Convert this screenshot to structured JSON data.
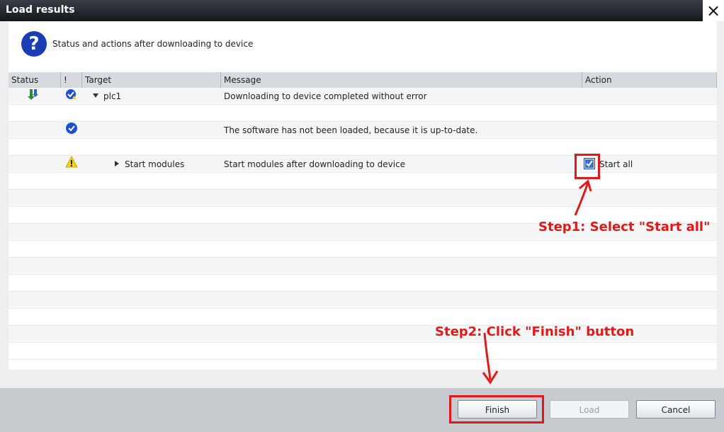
{
  "dialog": {
    "title": "Load results",
    "close_label": "×",
    "header_text": "Status and actions after downloading to device"
  },
  "table": {
    "columns": [
      "Status",
      "!",
      "Target",
      "Message",
      "Action"
    ],
    "rows": [
      {
        "status_icon": "download-arrow-icon",
        "severity_icon": "check-badge-icon",
        "target": "plc1",
        "message": "Downloading to device completed without error",
        "action": ""
      },
      {
        "status_icon": "",
        "severity_icon": "",
        "target": "",
        "message": "",
        "action": ""
      },
      {
        "status_icon": "",
        "severity_icon": "check-circle-icon",
        "target": "",
        "message": "The software has not been loaded, because it is up-to-date.",
        "action": ""
      },
      {
        "status_icon": "",
        "severity_icon": "",
        "target": "",
        "message": "",
        "action": ""
      },
      {
        "status_icon": "",
        "severity_icon": "warning-icon",
        "target": "Start modules",
        "message": "Start modules after downloading to device",
        "action": "Start all",
        "action_checked": true
      }
    ]
  },
  "annotations": {
    "step1": "Step1: Select \"Start all\"",
    "step2": "Step2: Click \"Finish\" button"
  },
  "buttons": {
    "finish": "Finish",
    "load": "Load",
    "cancel": "Cancel"
  },
  "colors": {
    "annotation_red": "#e01a1a",
    "question_icon_blue": "#1a3cb4",
    "check_blue": "#1b4fd6",
    "warning_yellow": "#f2d31b"
  }
}
